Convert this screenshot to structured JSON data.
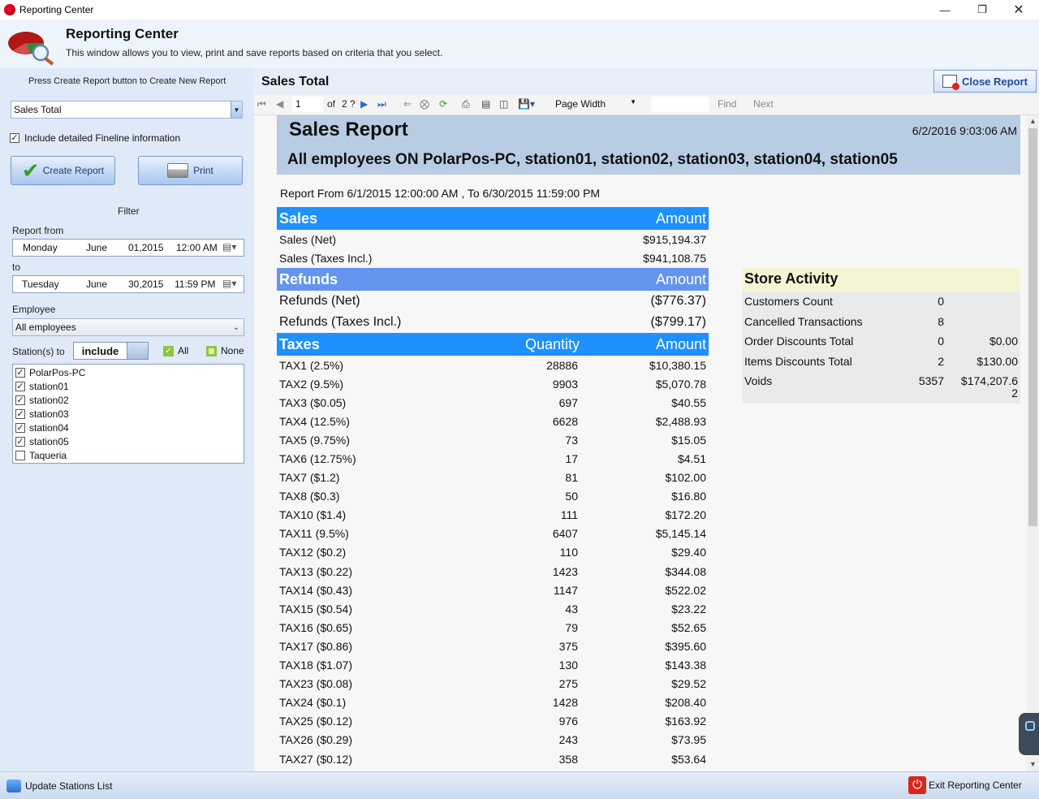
{
  "window": {
    "title": "Reporting Center"
  },
  "header": {
    "title": "Reporting Center",
    "subtitle": "This window allows you to view, print and save reports based on criteria that you select."
  },
  "left": {
    "hint": "Press Create Report button to Create New Report",
    "report_type": "Sales Total",
    "include_detailed_label": "Include detailed Fineline information",
    "include_detailed_checked": true,
    "create_label": "Create Report",
    "print_label": "Print",
    "filter_label": "Filter",
    "from_label": "Report from",
    "from": {
      "weekday": "Monday",
      "month": "June",
      "day": "01,2015",
      "time": "12:00 AM"
    },
    "to_label": "to",
    "to": {
      "weekday": "Tuesday",
      "month": "June",
      "day": "30,2015",
      "time": "11:59 PM"
    },
    "employee_label": "Employee",
    "employee_value": "All employees",
    "stations_label": "Station(s) to",
    "stations_mode": "include",
    "all_label": "All",
    "none_label": "None",
    "stations": [
      {
        "name": "PolarPos-PC",
        "checked": true
      },
      {
        "name": "station01",
        "checked": true
      },
      {
        "name": "station02",
        "checked": true
      },
      {
        "name": "station03",
        "checked": true
      },
      {
        "name": "station04",
        "checked": true
      },
      {
        "name": "station05",
        "checked": true
      },
      {
        "name": "Taqueria",
        "checked": false
      }
    ]
  },
  "viewer": {
    "title": "Sales Total",
    "close_label": "Close Report",
    "page": "1",
    "of_label": "of",
    "total_pages": "2 ?",
    "zoom": "Page Width",
    "find_label": "Find",
    "next_label": "Next"
  },
  "report": {
    "title": "Sales Report",
    "datetime": "6/2/2016 9:03:06 AM",
    "subtitle": "All employees ON PolarPos-PC, station01, station02, station03, station04, station05",
    "range": "Report From 6/1/2015 12:00:00 AM , To 6/30/2015 11:59:00 PM",
    "sales": {
      "header": "Sales",
      "amount_header": "Amount",
      "rows": [
        {
          "label": "Sales (Net)",
          "amount": "$915,194.37"
        },
        {
          "label": "Sales (Taxes Incl.)",
          "amount": "$941,108.75"
        }
      ]
    },
    "refunds": {
      "header": "Refunds",
      "amount_header": "Amount",
      "rows": [
        {
          "label": "Refunds (Net)",
          "amount": "($776.37)"
        },
        {
          "label": "Refunds (Taxes Incl.)",
          "amount": "($799.17)"
        }
      ]
    },
    "taxes": {
      "header": "Taxes",
      "quantity_header": "Quantity",
      "amount_header": "Amount",
      "rows": [
        {
          "label": "TAX1 (2.5%)",
          "qty": "28886",
          "amount": "$10,380.15"
        },
        {
          "label": "TAX2 (9.5%)",
          "qty": "9903",
          "amount": "$5,070.78"
        },
        {
          "label": "TAX3 ($0.05)",
          "qty": "697",
          "amount": "$40.55"
        },
        {
          "label": "TAX4 (12.5%)",
          "qty": "6628",
          "amount": "$2,488.93"
        },
        {
          "label": "TAX5 (9.75%)",
          "qty": "73",
          "amount": "$15.05"
        },
        {
          "label": "TAX6 (12.75%)",
          "qty": "17",
          "amount": "$4.51"
        },
        {
          "label": "TAX7 ($1.2)",
          "qty": "81",
          "amount": "$102.00"
        },
        {
          "label": "TAX8 ($0.3)",
          "qty": "50",
          "amount": "$16.80"
        },
        {
          "label": "TAX10 ($1.4)",
          "qty": "111",
          "amount": "$172.20"
        },
        {
          "label": "TAX11 (9.5%)",
          "qty": "6407",
          "amount": "$5,145.14"
        },
        {
          "label": "TAX12 ($0.2)",
          "qty": "110",
          "amount": "$29.40"
        },
        {
          "label": "TAX13 ($0.22)",
          "qty": "1423",
          "amount": "$344.08"
        },
        {
          "label": "TAX14 ($0.43)",
          "qty": "1147",
          "amount": "$522.02"
        },
        {
          "label": "TAX15 ($0.54)",
          "qty": "43",
          "amount": "$23.22"
        },
        {
          "label": "TAX16 ($0.65)",
          "qty": "79",
          "amount": "$52.65"
        },
        {
          "label": "TAX17 ($0.86)",
          "qty": "375",
          "amount": "$395.60"
        },
        {
          "label": "TAX18 ($1.07)",
          "qty": "130",
          "amount": "$143.38"
        },
        {
          "label": "TAX23 ($0.08)",
          "qty": "275",
          "amount": "$29.52"
        },
        {
          "label": "TAX24 ($0.1)",
          "qty": "1428",
          "amount": "$208.40"
        },
        {
          "label": "TAX25 ($0.12)",
          "qty": "976",
          "amount": "$163.92"
        },
        {
          "label": "TAX26 ($0.29)",
          "qty": "243",
          "amount": "$73.95"
        },
        {
          "label": "TAX27 ($0.12)",
          "qty": "358",
          "amount": "$53.64"
        }
      ]
    },
    "store_activity": {
      "header": "Store Activity",
      "rows": [
        {
          "label": "Customers Count",
          "count": "0",
          "amount": ""
        },
        {
          "label": "Cancelled Transactions",
          "count": "8",
          "amount": ""
        },
        {
          "label": "Order Discounts Total",
          "count": "0",
          "amount": "$0.00"
        },
        {
          "label": "Items Discounts Total",
          "count": "2",
          "amount": "$130.00"
        },
        {
          "label": "Voids",
          "count": "5357",
          "amount": "$174,207.6",
          "amount_wrap": "2"
        }
      ]
    }
  },
  "status": {
    "update_label": "Update Stations List",
    "exit_label": "Exit Reporting Center"
  },
  "colors": {
    "sales_bar": "#1e90ff",
    "refunds_bar": "#6495ed",
    "header_band": "#b8cde4",
    "store_header": "#f5f5d4"
  }
}
